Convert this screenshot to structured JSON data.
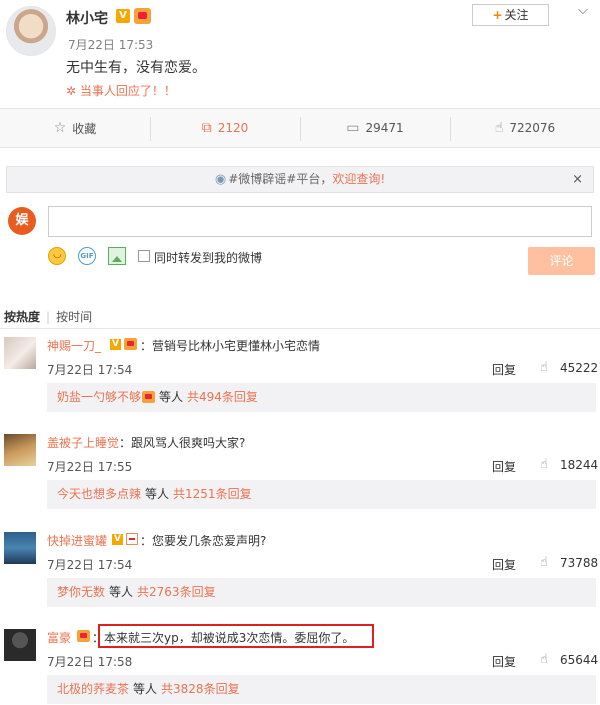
{
  "post": {
    "username": "林小宅",
    "v_badge": "V",
    "time": "7月22日 17:53",
    "text": "无中生有，没有恋爱。",
    "link_icon": "✲",
    "link_text": "当事人回应了！！",
    "follow_label": "关注",
    "follow_plus": "+",
    "menu_icon": "chevron-down"
  },
  "actions": {
    "favorite": {
      "icon": "star-icon",
      "label": "收藏"
    },
    "forward": {
      "icon": "forward-icon",
      "count": "2120"
    },
    "comment": {
      "icon": "comment-icon",
      "count": "29471"
    },
    "like": {
      "icon": "thumbs-up-icon",
      "count": "722076"
    }
  },
  "rumor_bar": {
    "text": "#微博辟谣#平台，",
    "highlight": "欢迎查询!",
    "close": "×"
  },
  "composer": {
    "avatar_text": "娱",
    "input_value": "",
    "repost_label": "同时转发到我的微博",
    "submit_label": "评论",
    "gif_label": "GIF"
  },
  "sort": {
    "hot": "按热度",
    "sep": "|",
    "time": "按时间"
  },
  "comments": [
    {
      "name": "神赐一刀_",
      "badges": [
        "v",
        "crown"
      ],
      "text": "：营销号比林小宅更懂林小宅恋情",
      "time": "7月22日 17:54",
      "reply": "回复",
      "likes": "45222",
      "sub_name": "奶盐一勺够不够",
      "sub_mid": "等人",
      "sub_count": "共494条回复"
    },
    {
      "name": "盖被子上睡觉",
      "badges": [],
      "text": "：跟风骂人很爽吗大家?",
      "time": "7月22日 17:55",
      "reply": "回复",
      "likes": "18244",
      "sub_name": "今天也想多点辣",
      "sub_mid": "等人",
      "sub_count": "共1251条回复"
    },
    {
      "name": "快掉进蜜罐",
      "badges": [
        "v",
        "hourglass"
      ],
      "text": "：您要发几条恋爱声明?",
      "time": "7月22日 17:54",
      "reply": "回复",
      "likes": "73788",
      "sub_name": "梦你无数",
      "sub_mid": "等人",
      "sub_count": "共2763条回复"
    },
    {
      "name": "富豪",
      "badges": [
        "crown"
      ],
      "text": "：本来就三次yp，却被说成3次恋情。委屈你了。",
      "time": "7月22日 17:58",
      "reply": "回复",
      "likes": "65644",
      "sub_name": "北极的荞麦茶",
      "sub_mid": "等人",
      "sub_count": "共3828条回复"
    }
  ],
  "colors": {
    "accent": "#eb7350",
    "highlight_box": "#e0201c",
    "submit_disabled": "#ffc09f"
  }
}
